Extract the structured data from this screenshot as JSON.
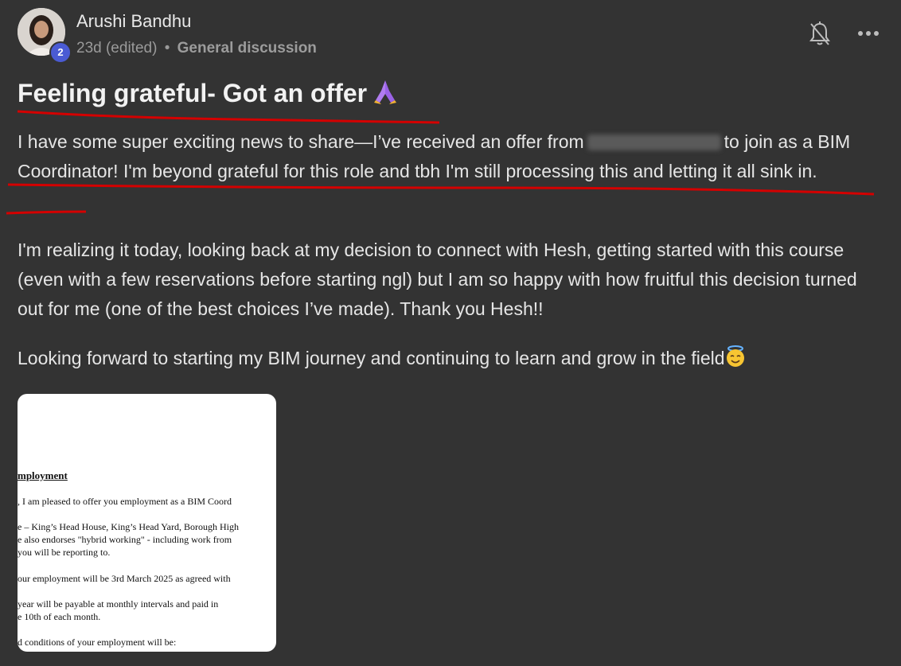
{
  "author": {
    "name": "Arushi Bandhu",
    "level": "2"
  },
  "meta": {
    "time": "23d (edited)",
    "separator": "•",
    "category": "General discussion"
  },
  "post": {
    "title": "Feeling grateful- Got an offer",
    "p1_before": "I have some super exciting news to share—I’ve received an offer from",
    "p1_after": "to join as a BIM Coordinator! I'm beyond grateful for this role and tbh I'm still processing this and letting it all sink in.",
    "p2": "I'm realizing it today, looking back at my decision to connect with Hesh, getting started with this course (even with a few reservations before starting ngl) but I am so happy with how fruitful this decision turned out for me (one of the best choices I’ve made). Thank you Hesh!!",
    "p3": "Looking forward to starting my BIM journey and continuing to learn and grow in the field"
  },
  "attachment": {
    "heading": "mployment",
    "line1": ", I am pleased to offer you employment as a BIM Coord",
    "line2": "e – King’s Head House, King’s Head Yard, Borough High",
    "line3": "e also endorses \"hybrid working\" - including work from",
    "line4": "you will be reporting to.",
    "line5": "our employment will be 3rd March 2025 as agreed with",
    "line6": "year will be payable at monthly intervals and paid in",
    "line7": "e 10th of each month.",
    "line8": "d conditions of your employment will be:"
  },
  "icons": {
    "bell": "bell-off-icon",
    "more": "more-horizontal-icon",
    "pray": "folded-hands-emoji",
    "halo": "smiling-face-with-halo-emoji"
  },
  "colors": {
    "background": "#333333",
    "annotation": "#d40000",
    "badge": "#4a5bd4"
  }
}
